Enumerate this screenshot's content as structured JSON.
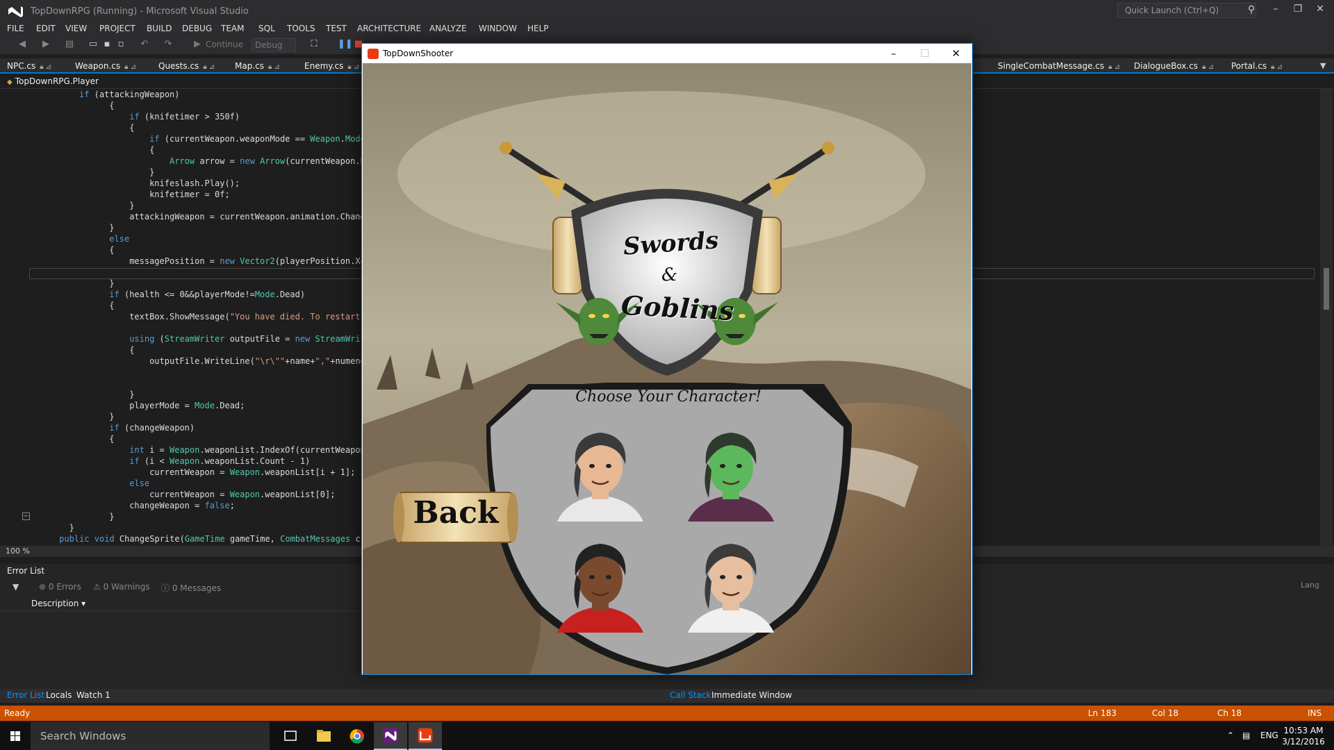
{
  "vs": {
    "title": "TopDownRPG (Running) - Microsoft Visual Studio",
    "quick_launch_placeholder": "Quick Launch (Ctrl+Q)",
    "menu": [
      "FILE",
      "EDIT",
      "VIEW",
      "PROJECT",
      "BUILD",
      "DEBUG",
      "TEAM",
      "SQL",
      "TOOLS",
      "TEST",
      "ARCHITECTURE",
      "ANALYZE",
      "WINDOW",
      "HELP"
    ],
    "toolbar": {
      "continue_label": "Continue",
      "configuration": "Debug"
    },
    "doc_tabs": [
      "NPC.cs",
      "Weapon.cs",
      "Quests.cs",
      "Map.cs",
      "Enemy.cs",
      "SingleCombatMessage.cs",
      "DialogueBox.cs",
      "Portal.cs"
    ],
    "nav_class": "TopDownRPG.Player",
    "zoom": "100 %"
  },
  "code_lines": [
    [
      [
        "if",
        "kw"
      ],
      [
        " (attackingWeapon)",
        ""
      ]
    ],
    [
      [
        "    {",
        ""
      ]
    ],
    [
      [
        "        ",
        ""
      ],
      [
        "if",
        "kw"
      ],
      [
        " (knifetimer > 350f)",
        ""
      ]
    ],
    [
      [
        "        {",
        ""
      ]
    ],
    [
      [
        "            ",
        ""
      ],
      [
        "if",
        "kw"
      ],
      [
        " (currentWeapon.weaponMode == ",
        ""
      ],
      [
        "Weapon",
        "ty"
      ],
      [
        ".",
        ""
      ],
      [
        "Mode",
        "ty"
      ],
      [
        ".",
        ""
      ]
    ],
    [
      [
        "            {",
        ""
      ]
    ],
    [
      [
        "                ",
        ""
      ],
      [
        "Arrow",
        "ty"
      ],
      [
        " arrow = ",
        ""
      ],
      [
        "new",
        "kw"
      ],
      [
        " ",
        ""
      ],
      [
        "Arrow",
        "ty"
      ],
      [
        "(currentWeapon.bu",
        ""
      ]
    ],
    [
      [
        "            }",
        ""
      ]
    ],
    [
      [
        "            knifeslash.Play();",
        ""
      ]
    ],
    [
      [
        "            knifetimer = 0f;",
        ""
      ]
    ],
    [
      [
        "        }",
        ""
      ]
    ],
    [
      [
        "        attackingWeapon = currentWeapon.animation.Change",
        ""
      ]
    ],
    [
      [
        "    }",
        ""
      ]
    ],
    [
      [
        "    ",
        ""
      ],
      [
        "else",
        "kw"
      ]
    ],
    [
      [
        "    {",
        ""
      ]
    ],
    [
      [
        "        messagePosition = ",
        ""
      ],
      [
        "new",
        "kw"
      ],
      [
        " ",
        ""
      ],
      [
        "Vector2",
        "ty"
      ],
      [
        "(playerPosition.X+1",
        ""
      ]
    ],
    [
      [
        "",
        ""
      ]
    ],
    [
      [
        "    }",
        ""
      ]
    ],
    [
      [
        "    ",
        ""
      ],
      [
        "if",
        "kw"
      ],
      [
        " (health <= 0&&playerMode!=",
        ""
      ],
      [
        "Mode",
        "ty"
      ],
      [
        ".Dead)",
        ""
      ]
    ],
    [
      [
        "    {",
        ""
      ]
    ],
    [
      [
        "        textBox.ShowMessage(",
        ""
      ],
      [
        "\"You have died. To restart p",
        "st"
      ]
    ],
    [
      [
        "",
        ""
      ]
    ],
    [
      [
        "        ",
        ""
      ],
      [
        "using",
        "kw"
      ],
      [
        " (",
        ""
      ],
      [
        "StreamWriter",
        "ty"
      ],
      [
        " outputFile = ",
        ""
      ],
      [
        "new",
        "kw"
      ],
      [
        " ",
        ""
      ],
      [
        "StreamWrite",
        "ty"
      ]
    ],
    [
      [
        "        {",
        ""
      ]
    ],
    [
      [
        "            outputFile.WriteLine(",
        ""
      ],
      [
        "\"\\r\\\"\"",
        "st"
      ],
      [
        "+name+",
        ""
      ],
      [
        "\",\"",
        "st"
      ],
      [
        "+numenem",
        ""
      ]
    ],
    [
      [
        "",
        ""
      ]
    ],
    [
      [
        "",
        ""
      ]
    ],
    [
      [
        "        }",
        ""
      ]
    ],
    [
      [
        "        playerMode = ",
        ""
      ],
      [
        "Mode",
        "ty"
      ],
      [
        ".Dead;",
        ""
      ]
    ],
    [
      [
        "    }",
        ""
      ]
    ],
    [
      [
        "    ",
        ""
      ],
      [
        "if",
        "kw"
      ],
      [
        " (changeWeapon)",
        ""
      ]
    ],
    [
      [
        "    {",
        ""
      ]
    ],
    [
      [
        "        ",
        ""
      ],
      [
        "int",
        "kw"
      ],
      [
        " i = ",
        ""
      ],
      [
        "Weapon",
        "ty"
      ],
      [
        ".weaponList.IndexOf(currentWeapon)",
        ""
      ]
    ],
    [
      [
        "        ",
        ""
      ],
      [
        "if",
        "kw"
      ],
      [
        " (i < ",
        ""
      ],
      [
        "Weapon",
        "ty"
      ],
      [
        ".weaponList.Count - 1)",
        ""
      ]
    ],
    [
      [
        "            currentWeapon = ",
        ""
      ],
      [
        "Weapon",
        "ty"
      ],
      [
        ".weaponList[i + 1];",
        ""
      ]
    ],
    [
      [
        "        ",
        ""
      ],
      [
        "else",
        "kw"
      ]
    ],
    [
      [
        "            currentWeapon = ",
        ""
      ],
      [
        "Weapon",
        "ty"
      ],
      [
        ".weaponList[0];",
        ""
      ]
    ],
    [
      [
        "        changeWeapon = ",
        ""
      ],
      [
        "false",
        "kw"
      ],
      [
        ";",
        ""
      ]
    ],
    [
      [
        "    }",
        ""
      ]
    ],
    [
      [
        "}",
        ""
      ]
    ],
    [
      [
        "",
        ""
      ],
      [
        "public",
        "kw"
      ],
      [
        " ",
        ""
      ],
      [
        "void",
        "kw"
      ],
      [
        " ChangeSprite(",
        ""
      ],
      [
        "GameTime",
        "ty"
      ],
      [
        " gameTime, ",
        ""
      ],
      [
        "CombatMessages",
        "ty"
      ],
      [
        " c",
        ""
      ]
    ],
    [
      [
        "{",
        ""
      ]
    ],
    [
      [
        "    timer += (",
        ""
      ],
      [
        "float",
        "kw"
      ],
      [
        ")gameTime.ElapsedGameTime.TotalMillisecon",
        ""
      ]
    ]
  ],
  "code_indent": [
    10,
    12,
    12,
    12,
    12,
    12,
    12,
    12,
    12,
    12,
    12,
    12,
    12,
    12,
    12,
    12,
    12,
    12,
    12,
    12,
    12,
    12,
    12,
    12,
    12,
    12,
    12,
    12,
    12,
    12,
    12,
    12,
    12,
    12,
    12,
    12,
    12,
    12,
    12,
    8,
    6,
    6,
    6
  ],
  "error_list": {
    "title": "Error List",
    "errors": "0 Errors",
    "warnings": "0 Warnings",
    "messages": "0 Messages",
    "column_description": "Description",
    "column_lang": "Lang"
  },
  "bottom_tabs": {
    "left": [
      "Error List",
      "Locals",
      "Watch 1"
    ],
    "right": [
      "Call Stack",
      "Immediate Window"
    ]
  },
  "status": {
    "ready": "Ready",
    "ln": "Ln 183",
    "col": "Col 18",
    "ch": "Ch 18",
    "ins": "INS"
  },
  "taskbar": {
    "search_placeholder": "Search Windows",
    "language": "ENG",
    "time": "10:53 AM",
    "date": "3/12/2016"
  },
  "game": {
    "window_title": "TopDownShooter",
    "crest_line1": "Swords",
    "crest_amp": "&",
    "crest_line2": "Goblins",
    "heading": "Choose Your Character!",
    "back_label": "Back",
    "characters": [
      {
        "skin": "#e8b894",
        "hair": "#3a3a3a",
        "shirt": "#e8e8e8"
      },
      {
        "skin": "#5cb85c",
        "hair": "#2e3a2e",
        "shirt": "#5a2e4a"
      },
      {
        "skin": "#7a4a2e",
        "hair": "#222222",
        "shirt": "#c8201e"
      },
      {
        "skin": "#e6bfa0",
        "hair": "#3b3b3b",
        "shirt": "#f0f0f0"
      }
    ]
  },
  "colors": {
    "accent": "#007acc",
    "status_bar": "#ca5100",
    "keyword": "#569cd6",
    "type": "#4ec9b0",
    "string": "#d69d85"
  }
}
